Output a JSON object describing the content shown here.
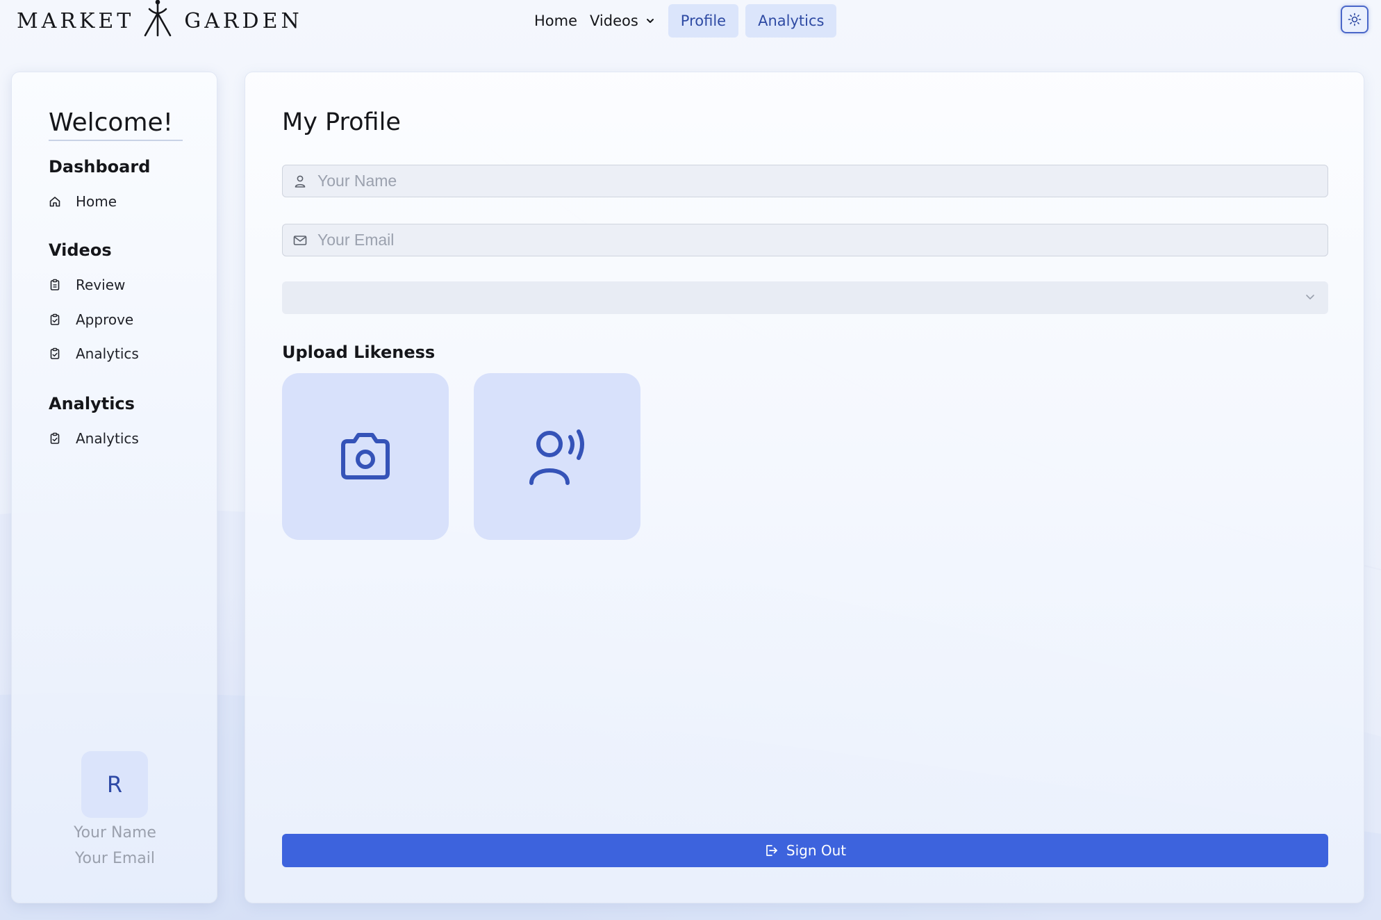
{
  "brand": {
    "name_left": "MARKET",
    "name_right": "GARDEN"
  },
  "topnav": {
    "home": "Home",
    "videos": "Videos",
    "profile": "Profile",
    "analytics": "Analytics"
  },
  "sidebar": {
    "welcome": "Welcome!",
    "sections": [
      {
        "title": "Dashboard",
        "items": [
          {
            "label": "Home",
            "icon": "home-icon"
          }
        ]
      },
      {
        "title": "Videos",
        "items": [
          {
            "label": "Review",
            "icon": "clipboard-icon"
          },
          {
            "label": "Approve",
            "icon": "clipboard-check-icon"
          },
          {
            "label": "Analytics",
            "icon": "clipboard-check-icon"
          }
        ]
      },
      {
        "title": "Analytics",
        "items": [
          {
            "label": "Analytics",
            "icon": "clipboard-check-icon"
          }
        ]
      }
    ],
    "user": {
      "initial": "R",
      "name": "Your Name",
      "email": "Your Email"
    }
  },
  "main": {
    "title": "My Profile",
    "name_field": {
      "placeholder": "Your Name",
      "value": ""
    },
    "email_field": {
      "placeholder": "Your Email",
      "value": ""
    },
    "select": {
      "value": ""
    },
    "upload_title": "Upload Likeness",
    "signout_label": "Sign Out"
  },
  "colors": {
    "accent": "#3d63dd",
    "accent_dark": "#2e4aa3",
    "tile_bg": "#d8e1fb"
  }
}
